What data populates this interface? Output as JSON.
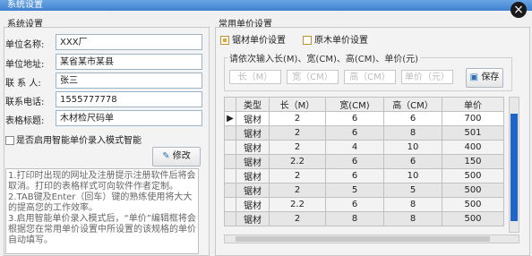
{
  "window": {
    "title": "系统设置"
  },
  "left_group": {
    "title": "系统设置",
    "fields": [
      {
        "label": "单位名称:",
        "value": "XXX厂"
      },
      {
        "label": "单位地址:",
        "value": "某省某市某县"
      },
      {
        "label": "联 系 人:",
        "value": "张三"
      },
      {
        "label": "联系电话:",
        "value": "1555777778"
      },
      {
        "label": "表格标题:",
        "value": "木材检尺码单"
      }
    ],
    "smart_checkbox_label": "是否启用智能单价录入模式智能",
    "modify_button": "修改",
    "notes": [
      "1.打印时出现的网址及注册提示注册软件后将会取消。打印的表格样式可向软件作者定制。",
      "2.TAB键及Enter（回车）键的熟练使用将大大的提高您的工作效率。",
      "3.启用智能单价录入模式后，“单价”编辑框将会根据您在常用单价设置中所设置的该规格的单价自动填写。"
    ]
  },
  "right_group": {
    "title": "常用单价设置",
    "radio_lumber": "锯材单价设置",
    "radio_log": "原木单价设置",
    "generator": {
      "title": "请依次输入长(M)、宽(CM)、高(CM)、单价(元)",
      "placeholders": [
        "长（M）",
        "宽（CM）",
        "高（CM）",
        "单价（元）"
      ],
      "save_button": "保存"
    },
    "table": {
      "headers": [
        "类型",
        "长（M）",
        "宽(CM)",
        "高（CM）",
        "单价"
      ],
      "rows": [
        [
          "锯材",
          "2",
          "6",
          "6",
          "700"
        ],
        [
          "锯材",
          "2",
          "6",
          "8",
          "501"
        ],
        [
          "锯材",
          "2",
          "4",
          "10",
          "400"
        ],
        [
          "锯材",
          "2.2",
          "6",
          "6",
          "150"
        ],
        [
          "锯材",
          "2",
          "6",
          "10",
          "500"
        ],
        [
          "锯材",
          "2",
          "5",
          "5",
          "500"
        ],
        [
          "锯材",
          "2.2",
          "6",
          "8",
          "500"
        ],
        [
          "锯材",
          "2",
          "8",
          "8",
          "500"
        ]
      ]
    }
  }
}
